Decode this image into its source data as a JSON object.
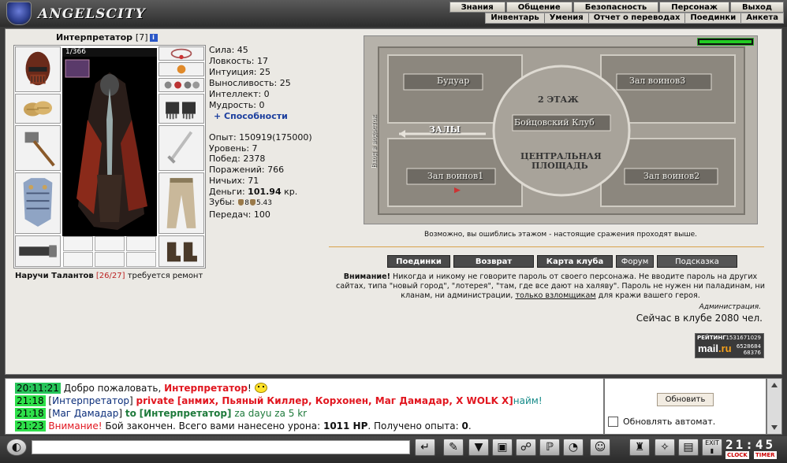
{
  "brand": {
    "name": "ANGELSCITY"
  },
  "menu": {
    "top": [
      "Знания",
      "Общение",
      "Безопасность",
      "Персонаж",
      "Выход"
    ],
    "sub": [
      "Инвентарь",
      "Умения",
      "Отчет о переводах",
      "Поединки",
      "Анкета"
    ]
  },
  "character": {
    "name": "Интерпретатор",
    "level": "[7]",
    "hp": "1/366",
    "stats": {
      "strength": "Сила: 45",
      "agility": "Ловкость: 17",
      "intuition": "Интуиция: 25",
      "endurance": "Выносливость: 25",
      "intellect": "Интеллект: 0",
      "wisdom": "Мудрость: 0",
      "abilities": "+ Способности"
    },
    "progress": {
      "exp": "Опыт: 150919(175000)",
      "level": "Уровень: 7",
      "wins": "Побед: 2378",
      "losses": "Поражений: 766",
      "draws": "Ничьих: 71",
      "money_label": "Деньги: ",
      "money_value": "101.94",
      "money_unit": " кр.",
      "teeth_label": "Зубы: ",
      "teeth_a": "8",
      "teeth_b": "5.43",
      "transfers": "Передач: 100"
    },
    "repair": {
      "item": "Наручи Талантов",
      "count": "[26/27]",
      "note": " требуется ремонт"
    }
  },
  "map": {
    "labels": {
      "boudoir": "Будуар",
      "warriors3": "Зал воинов3",
      "floor2": "2 ЭТАЖ",
      "club": "Бойцовский Клуб",
      "halls": "ЗАЛЫ",
      "central1": "ЦЕНТРАЛЬНАЯ",
      "central2": "ПЛОЩАДЬ",
      "warriors1": "Зал воинов1",
      "warriors2": "Зал воинов2",
      "entrance": "Вход в водосток"
    },
    "note": "Возможно, вы ошиблись этажом - настоящие сражения проходят выше."
  },
  "buttons": {
    "duels": "Поединки",
    "back": "Возврат",
    "club_map": "Карта клуба",
    "forum": "Форум",
    "hint": "Подсказка"
  },
  "warning": {
    "title": "Внимание!",
    "text1": " Никогда и никому не говорите пароль от своего персонажа. Не вводите пароль на других сайтах, типа \"новый город\", \"лотерея\", \"там, где все дают на халяву\". Пароль не нужен ни паладинам, ни кланам, ни администрации, ",
    "underlined": "только взломщикам",
    "text2": " для кражи вашего героя.",
    "admin": "Администрация.",
    "online": "Сейчас в клубе 2080 чел."
  },
  "rating": {
    "label": "РЕЙТИНГ",
    "n1": "1531671029",
    "n2": "6528684",
    "n3": "68376",
    "mail": "mail",
    "ru": ".ru"
  },
  "chat": [
    {
      "time": "20:11:21",
      "text": "Добро пожаловать, ",
      "nick": "Интерпретатор",
      "tail": "!"
    },
    {
      "time": "21:18",
      "from": "Интерпретатор",
      "type": "private",
      "to": "[анмих, Пьяный Киллер, Корхонен, Маг Дамадар, X WOLK X]",
      "msg": "найм!"
    },
    {
      "time": "21:18",
      "from": "Маг Дамадар",
      "type": "to",
      "to": "[Интерпретатор]",
      "msg": "za dayu za 5 kr"
    },
    {
      "time": "21:23",
      "alert": "Внимание!",
      "text": " Бой закончен. Всего вами нанесено урона: ",
      "dmg": "1011 HP",
      "text2": ". Получено опыта: ",
      "exp": "0",
      "end": "."
    }
  ],
  "side": {
    "refresh": "Обновить",
    "auto": "Обновлять автомат."
  },
  "clock": {
    "time": "21:45",
    "label1": "CLOCK",
    "label2": "TIMER"
  },
  "colors": {
    "accent": "#4a4a4a",
    "timestamp": "#27c55a",
    "alert": "#e1161f",
    "link": "#1c3f9e"
  }
}
